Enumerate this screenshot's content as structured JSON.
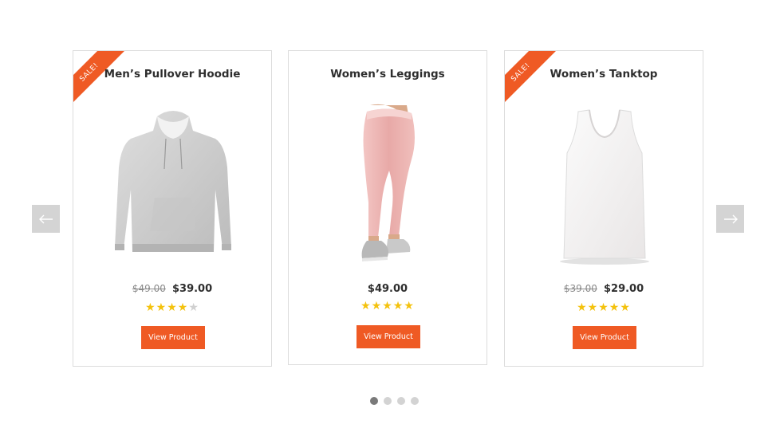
{
  "carousel": {
    "prev_icon": "arrow-left-icon",
    "next_icon": "arrow-right-icon",
    "dot_count": 4,
    "active_dot": 1
  },
  "colors": {
    "accent": "#ef5a24",
    "star_filled": "#f4c20d",
    "star_empty": "#d0d0d0"
  },
  "products": [
    {
      "title": "Men’s Pullover Hoodie",
      "sale_badge": "SALE!",
      "old_price": "$49.00",
      "price": "$39.00",
      "rating": 4,
      "rating_max": 5,
      "button_label": "View Product",
      "image": "grey-hoodie"
    },
    {
      "title": "Women’s Leggings",
      "price": "$49.00",
      "rating": 5,
      "rating_max": 5,
      "button_label": "View Product",
      "image": "pink-leggings"
    },
    {
      "title": "Women’s Tanktop",
      "sale_badge": "SALE!",
      "old_price": "$39.00",
      "price": "$29.00",
      "rating": 5,
      "rating_max": 5,
      "button_label": "View Product",
      "image": "white-tanktop"
    }
  ]
}
